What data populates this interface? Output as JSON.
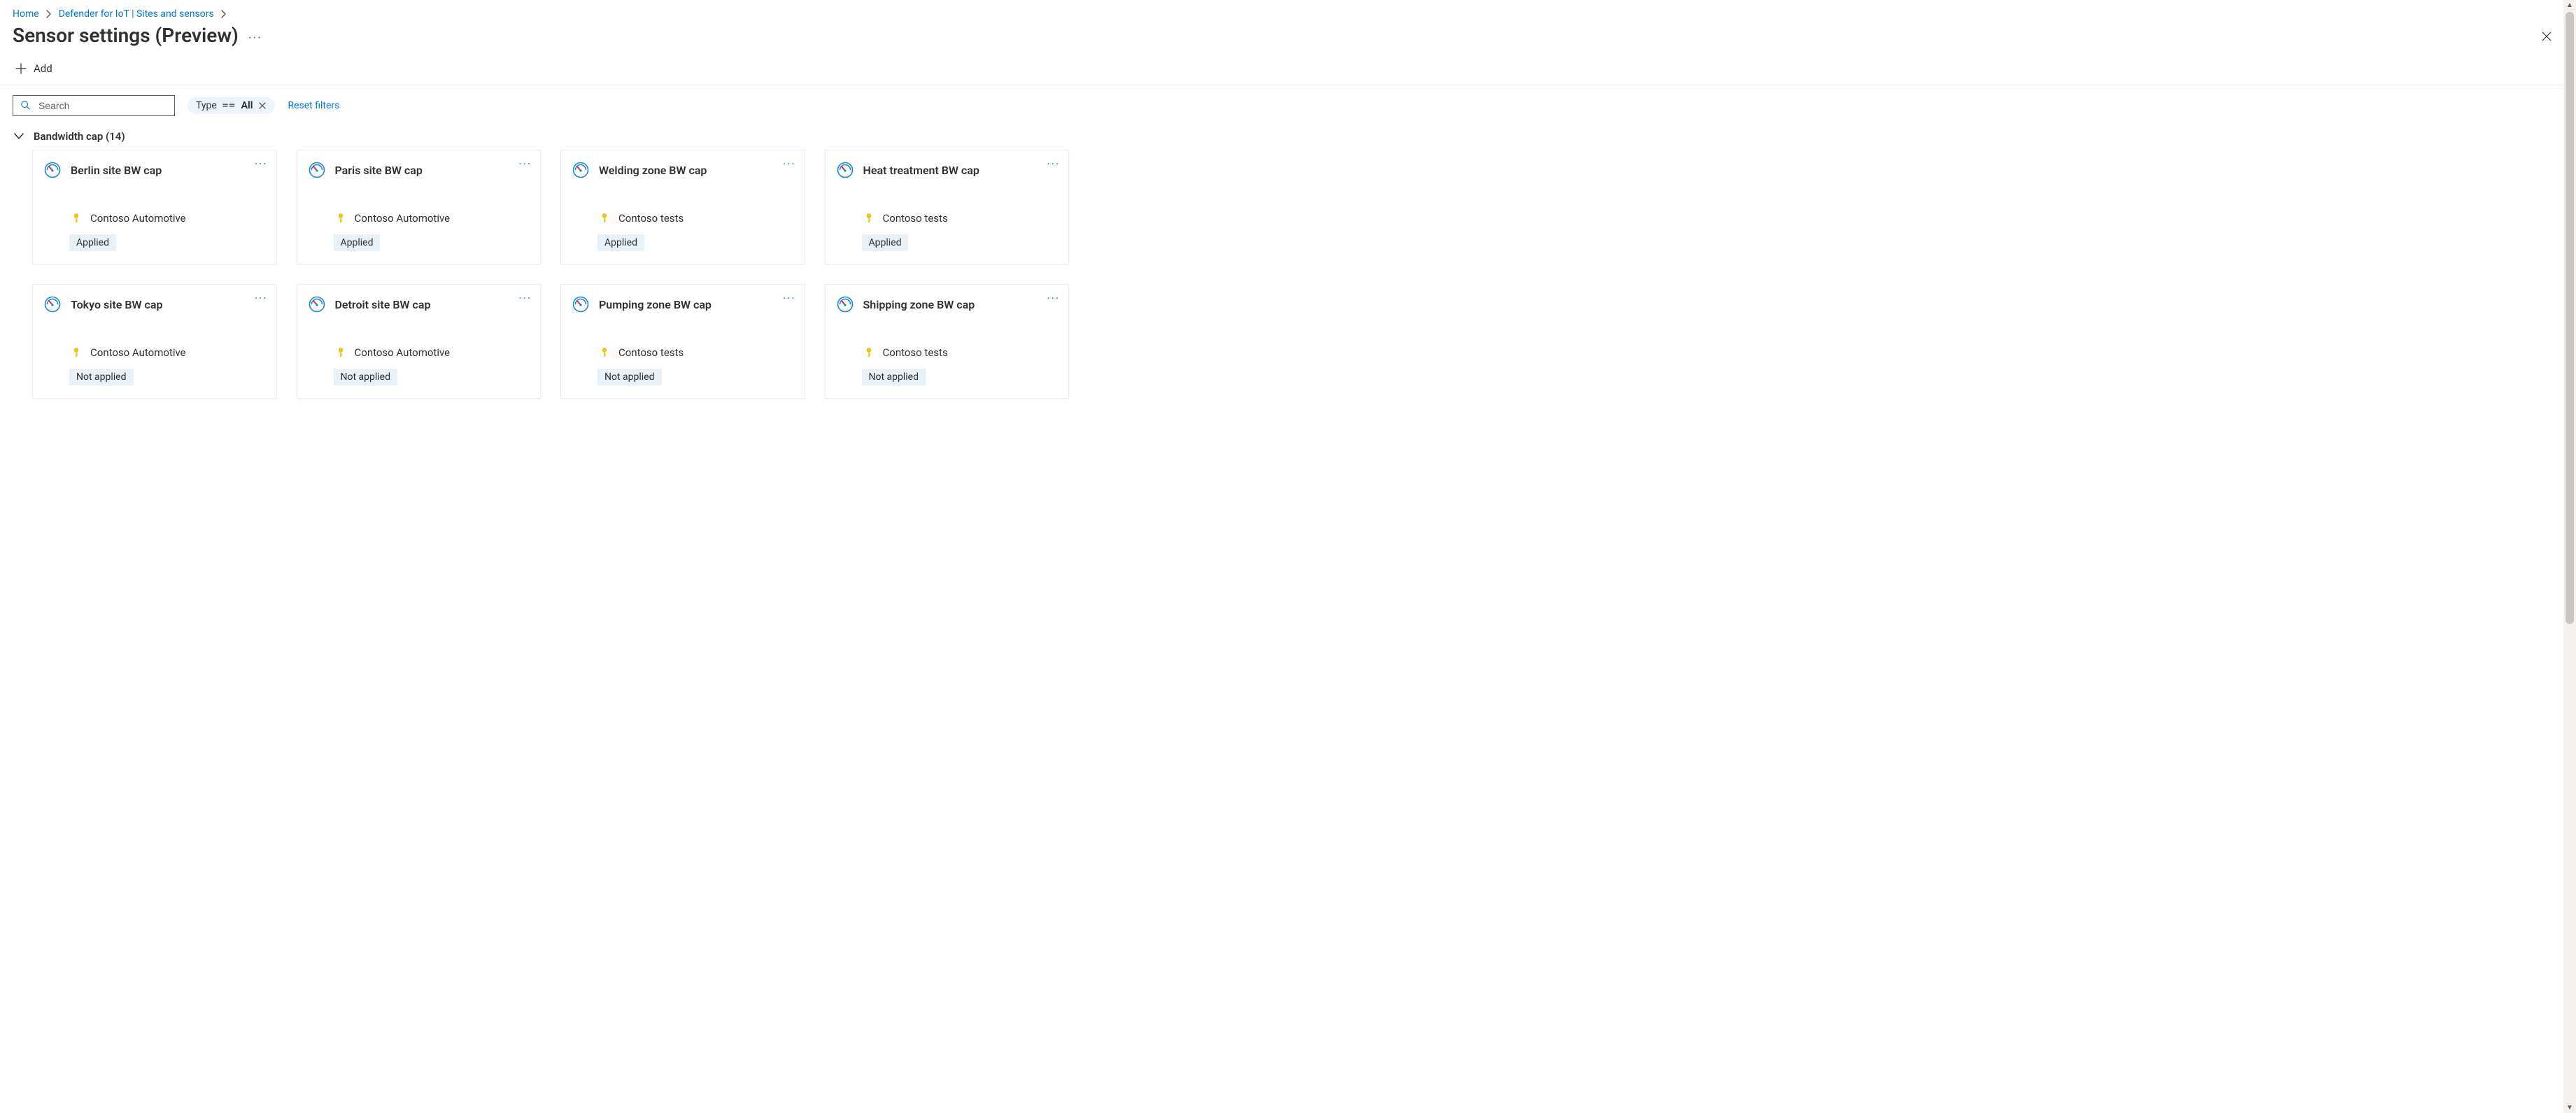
{
  "breadcrumb": {
    "items": [
      {
        "label": "Home"
      },
      {
        "label": "Defender for IoT | Sites and sensors"
      }
    ]
  },
  "page": {
    "title": "Sensor settings (Preview)"
  },
  "toolbar": {
    "add_label": "Add"
  },
  "search": {
    "placeholder": "Search"
  },
  "filter_pill": {
    "label": "Type",
    "operator": "==",
    "value": "All"
  },
  "reset_filters_label": "Reset filters",
  "group": {
    "title": "Bandwidth cap (14)"
  },
  "cards": [
    {
      "title": "Berlin site BW cap",
      "sub": "Contoso Automotive",
      "status": "Applied"
    },
    {
      "title": "Paris site BW cap",
      "sub": "Contoso Automotive",
      "status": "Applied"
    },
    {
      "title": "Welding zone BW cap",
      "sub": "Contoso tests",
      "status": "Applied"
    },
    {
      "title": "Heat treatment BW cap",
      "sub": "Contoso tests",
      "status": "Applied"
    },
    {
      "title": "Tokyo site BW cap",
      "sub": "Contoso Automotive",
      "status": "Not applied"
    },
    {
      "title": "Detroit site BW cap",
      "sub": "Contoso Automotive",
      "status": "Not applied"
    },
    {
      "title": "Pumping zone BW cap",
      "sub": "Contoso tests",
      "status": "Not applied"
    },
    {
      "title": "Shipping zone BW cap",
      "sub": "Contoso tests",
      "status": "Not applied"
    }
  ]
}
